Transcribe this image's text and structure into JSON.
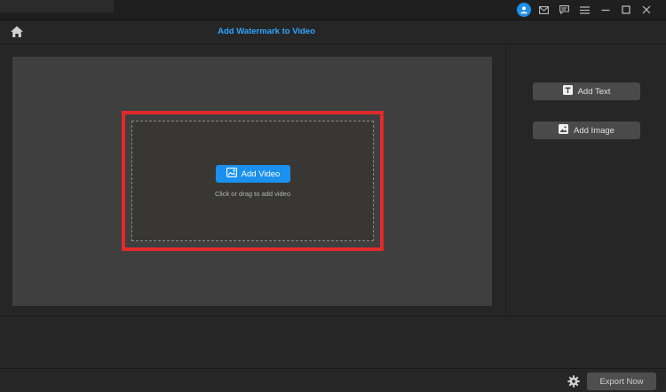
{
  "header": {
    "title": "Add Watermark to Video"
  },
  "upload": {
    "button_label": "Add Video",
    "hint": "Click or drag to add video"
  },
  "sidebar": {
    "add_text_label": "Add Text",
    "add_image_label": "Add Image"
  },
  "footer": {
    "export_label": "Export Now"
  },
  "icons": {
    "account": "user-icon",
    "mail": "mail-icon",
    "feedback": "chat-icon",
    "menu": "menu-icon",
    "minimize": "minimize-icon",
    "maximize": "maximize-icon",
    "close": "close-icon",
    "home": "home-icon",
    "settings": "gear-icon"
  },
  "colors": {
    "accent": "#1a90ef",
    "title": "#2ea6ff",
    "highlight": "#e22a2a"
  }
}
